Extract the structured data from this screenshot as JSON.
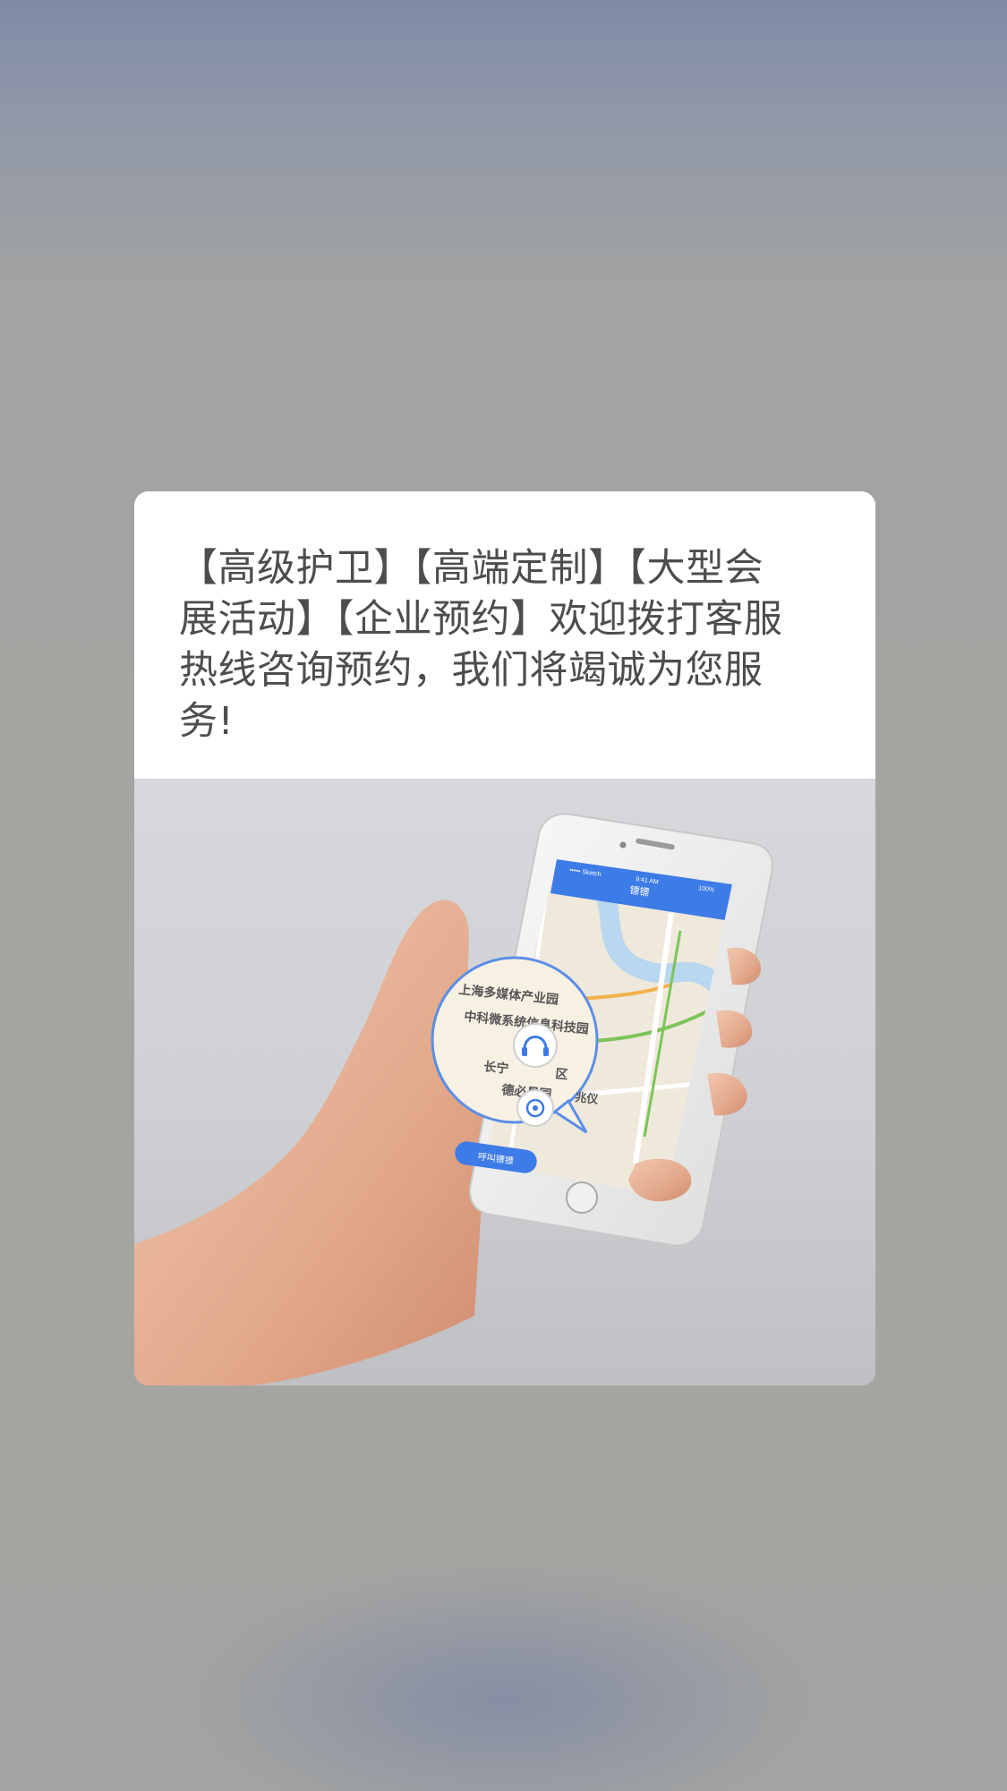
{
  "dialog": {
    "message": "【高级护卫】【高端定制】【大型会展活动】【企业预约】欢迎拨打客服热线咨询预约，我们将竭诚为您服务!"
  },
  "promo_image": {
    "description_icon": "phone-in-hand-map-icon",
    "phone_screen": {
      "status_carrier": "••••• Sketch",
      "status_time": "9:41 AM",
      "status_battery": "100%",
      "title": "镖镖",
      "map_labels": [
        "上海多媒体产业园",
        "中科微系统信息科技园",
        "长宁",
        "区",
        "德必易园",
        "兆仪"
      ],
      "call_button_label": "呼叫镖镖"
    }
  }
}
